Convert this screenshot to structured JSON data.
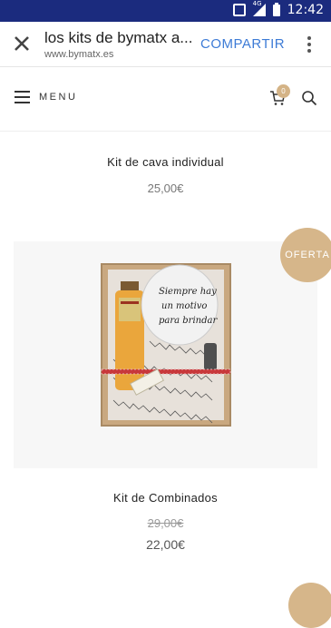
{
  "status_bar": {
    "time": "12:42",
    "network": "4G"
  },
  "toolbar": {
    "title": "los kits de bymatx a...",
    "url": "www.bymatx.es",
    "share_label": "COMPARTIR",
    "icons": [
      "close-icon",
      "more-vert-icon"
    ]
  },
  "header": {
    "menu_label": "MENU",
    "cart_count": "0",
    "icons": [
      "hamburger-icon",
      "cart-icon",
      "search-icon"
    ]
  },
  "products": [
    {
      "name": "Kit de cava individual",
      "price": "25,00€"
    },
    {
      "name": "Kit de Combinados",
      "old_price": "29,00€",
      "price": "22,00€",
      "badge": "OFERTA"
    }
  ],
  "product2_image_text": "Siempre hay un motivo para brindar",
  "colors": {
    "status_bar": "#1b2b7e",
    "accent_link": "#3d7bd6",
    "badge": "#d6b68a"
  }
}
